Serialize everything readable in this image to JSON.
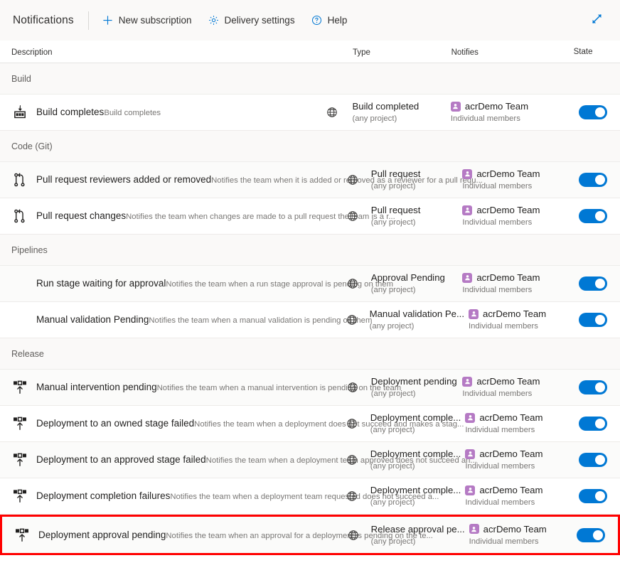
{
  "toolbar": {
    "title": "Notifications",
    "commands": [
      {
        "label": "New subscription",
        "icon": "plus-icon"
      },
      {
        "label": "Delivery settings",
        "icon": "gear-icon"
      },
      {
        "label": "Help",
        "icon": "help-circle-icon"
      }
    ],
    "expand_icon": "expand-diagonal-icon"
  },
  "table": {
    "columns": {
      "description": "Description",
      "type": "Type",
      "notifies": "Notifies",
      "state": "State"
    },
    "scope_icon": "globe-icon",
    "toggle_state": "on",
    "sections": [
      {
        "title": "Build",
        "rows": [
          {
            "icon": "build-icon",
            "title": "Build completes",
            "subtitle": "Build completes",
            "type": "Build completed",
            "type_scope": "(any project)",
            "notifies": "acrDemo Team",
            "notifies_sub": "Individual members",
            "state": "on",
            "highlighted": false
          }
        ]
      },
      {
        "title": "Code (Git)",
        "rows": [
          {
            "icon": "pull-request-icon",
            "title": "Pull request reviewers added or removed",
            "subtitle": "Notifies the team when it is added or removed as a reviewer for a pull requ...",
            "type": "Pull request",
            "type_scope": "(any project)",
            "notifies": "acrDemo Team",
            "notifies_sub": "Individual members",
            "state": "on",
            "highlighted": false
          },
          {
            "icon": "pull-request-icon",
            "title": "Pull request changes",
            "subtitle": "Notifies the team when changes are made to a pull request the team is a r...",
            "type": "Pull request",
            "type_scope": "(any project)",
            "notifies": "acrDemo Team",
            "notifies_sub": "Individual members",
            "state": "on",
            "highlighted": false
          }
        ]
      },
      {
        "title": "Pipelines",
        "rows": [
          {
            "icon": "none",
            "title": "Run stage waiting for approval",
            "subtitle": "Notifies the team when a run stage approval is pending on them",
            "type": "Approval Pending",
            "type_scope": "(any project)",
            "notifies": "acrDemo Team",
            "notifies_sub": "Individual members",
            "state": "on",
            "highlighted": false
          },
          {
            "icon": "none",
            "title": "Manual validation Pending",
            "subtitle": "Notifies the team when a manual validation is pending on them",
            "type": "Manual validation Pe...",
            "type_scope": "(any project)",
            "notifies": "acrDemo Team",
            "notifies_sub": "Individual members",
            "state": "on",
            "highlighted": false
          }
        ]
      },
      {
        "title": "Release",
        "rows": [
          {
            "icon": "release-icon",
            "title": "Manual intervention pending",
            "subtitle": "Notifies the team when a manual intervention is pending on the team",
            "type": "Deployment pending",
            "type_scope": "(any project)",
            "notifies": "acrDemo Team",
            "notifies_sub": "Individual members",
            "state": "on",
            "highlighted": false
          },
          {
            "icon": "release-icon",
            "title": "Deployment to an owned stage failed",
            "subtitle": "Notifies the team when a deployment does not succeed and makes a stag...",
            "type": "Deployment comple...",
            "type_scope": "(any project)",
            "notifies": "acrDemo Team",
            "notifies_sub": "Individual members",
            "state": "on",
            "highlighted": false
          },
          {
            "icon": "release-icon",
            "title": "Deployment to an approved stage failed",
            "subtitle": "Notifies the team when a deployment team approved does not succeed an...",
            "type": "Deployment comple...",
            "type_scope": "(any project)",
            "notifies": "acrDemo Team",
            "notifies_sub": "Individual members",
            "state": "on",
            "highlighted": false
          },
          {
            "icon": "release-icon",
            "title": "Deployment completion failures",
            "subtitle": "Notifies the team when a deployment team requested does not succeed a...",
            "type": "Deployment comple...",
            "type_scope": "(any project)",
            "notifies": "acrDemo Team",
            "notifies_sub": "Individual members",
            "state": "on",
            "highlighted": false
          },
          {
            "icon": "release-icon",
            "title": "Deployment approval pending",
            "subtitle": "Notifies the team when an approval for a deployment is pending on the te...",
            "type": "Release approval pe...",
            "type_scope": "(any project)",
            "notifies": "acrDemo Team",
            "notifies_sub": "Individual members",
            "state": "on",
            "highlighted": true
          }
        ]
      }
    ]
  },
  "colors": {
    "accent": "#0078d4",
    "avatar": "#b57ac4",
    "highlight_border": "#ff0000"
  }
}
